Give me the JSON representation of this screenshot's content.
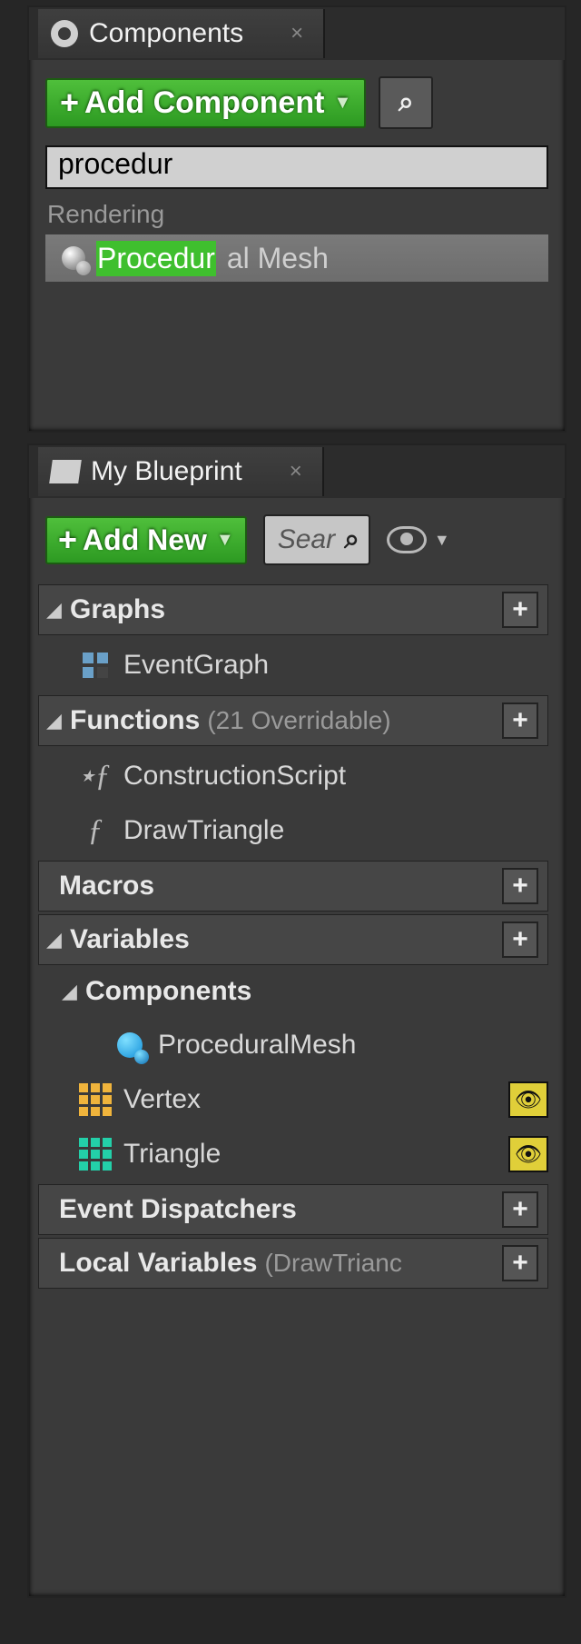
{
  "panels": {
    "components": {
      "tab_title": "Components",
      "add_button": "Add Component",
      "search_value": "procedur",
      "section": "Rendering",
      "result_highlight": "Procedur",
      "result_rest": "al Mesh"
    },
    "blueprint": {
      "tab_title": "My Blueprint",
      "add_button": "Add New",
      "search_placeholder": "Sear",
      "categories": {
        "graphs": {
          "label": "Graphs",
          "items": [
            "EventGraph"
          ]
        },
        "functions": {
          "label": "Functions",
          "extra": "(21 Overridable)",
          "items": [
            "ConstructionScript",
            "DrawTriangle"
          ]
        },
        "macros": {
          "label": "Macros"
        },
        "variables": {
          "label": "Variables"
        },
        "components_sub": {
          "label": "Components",
          "items": [
            "ProceduralMesh",
            "Vertex",
            "Triangle"
          ]
        },
        "dispatchers": {
          "label": "Event Dispatchers"
        },
        "local_vars": {
          "label": "Local Variables",
          "extra": "(DrawTrianc"
        }
      }
    }
  }
}
